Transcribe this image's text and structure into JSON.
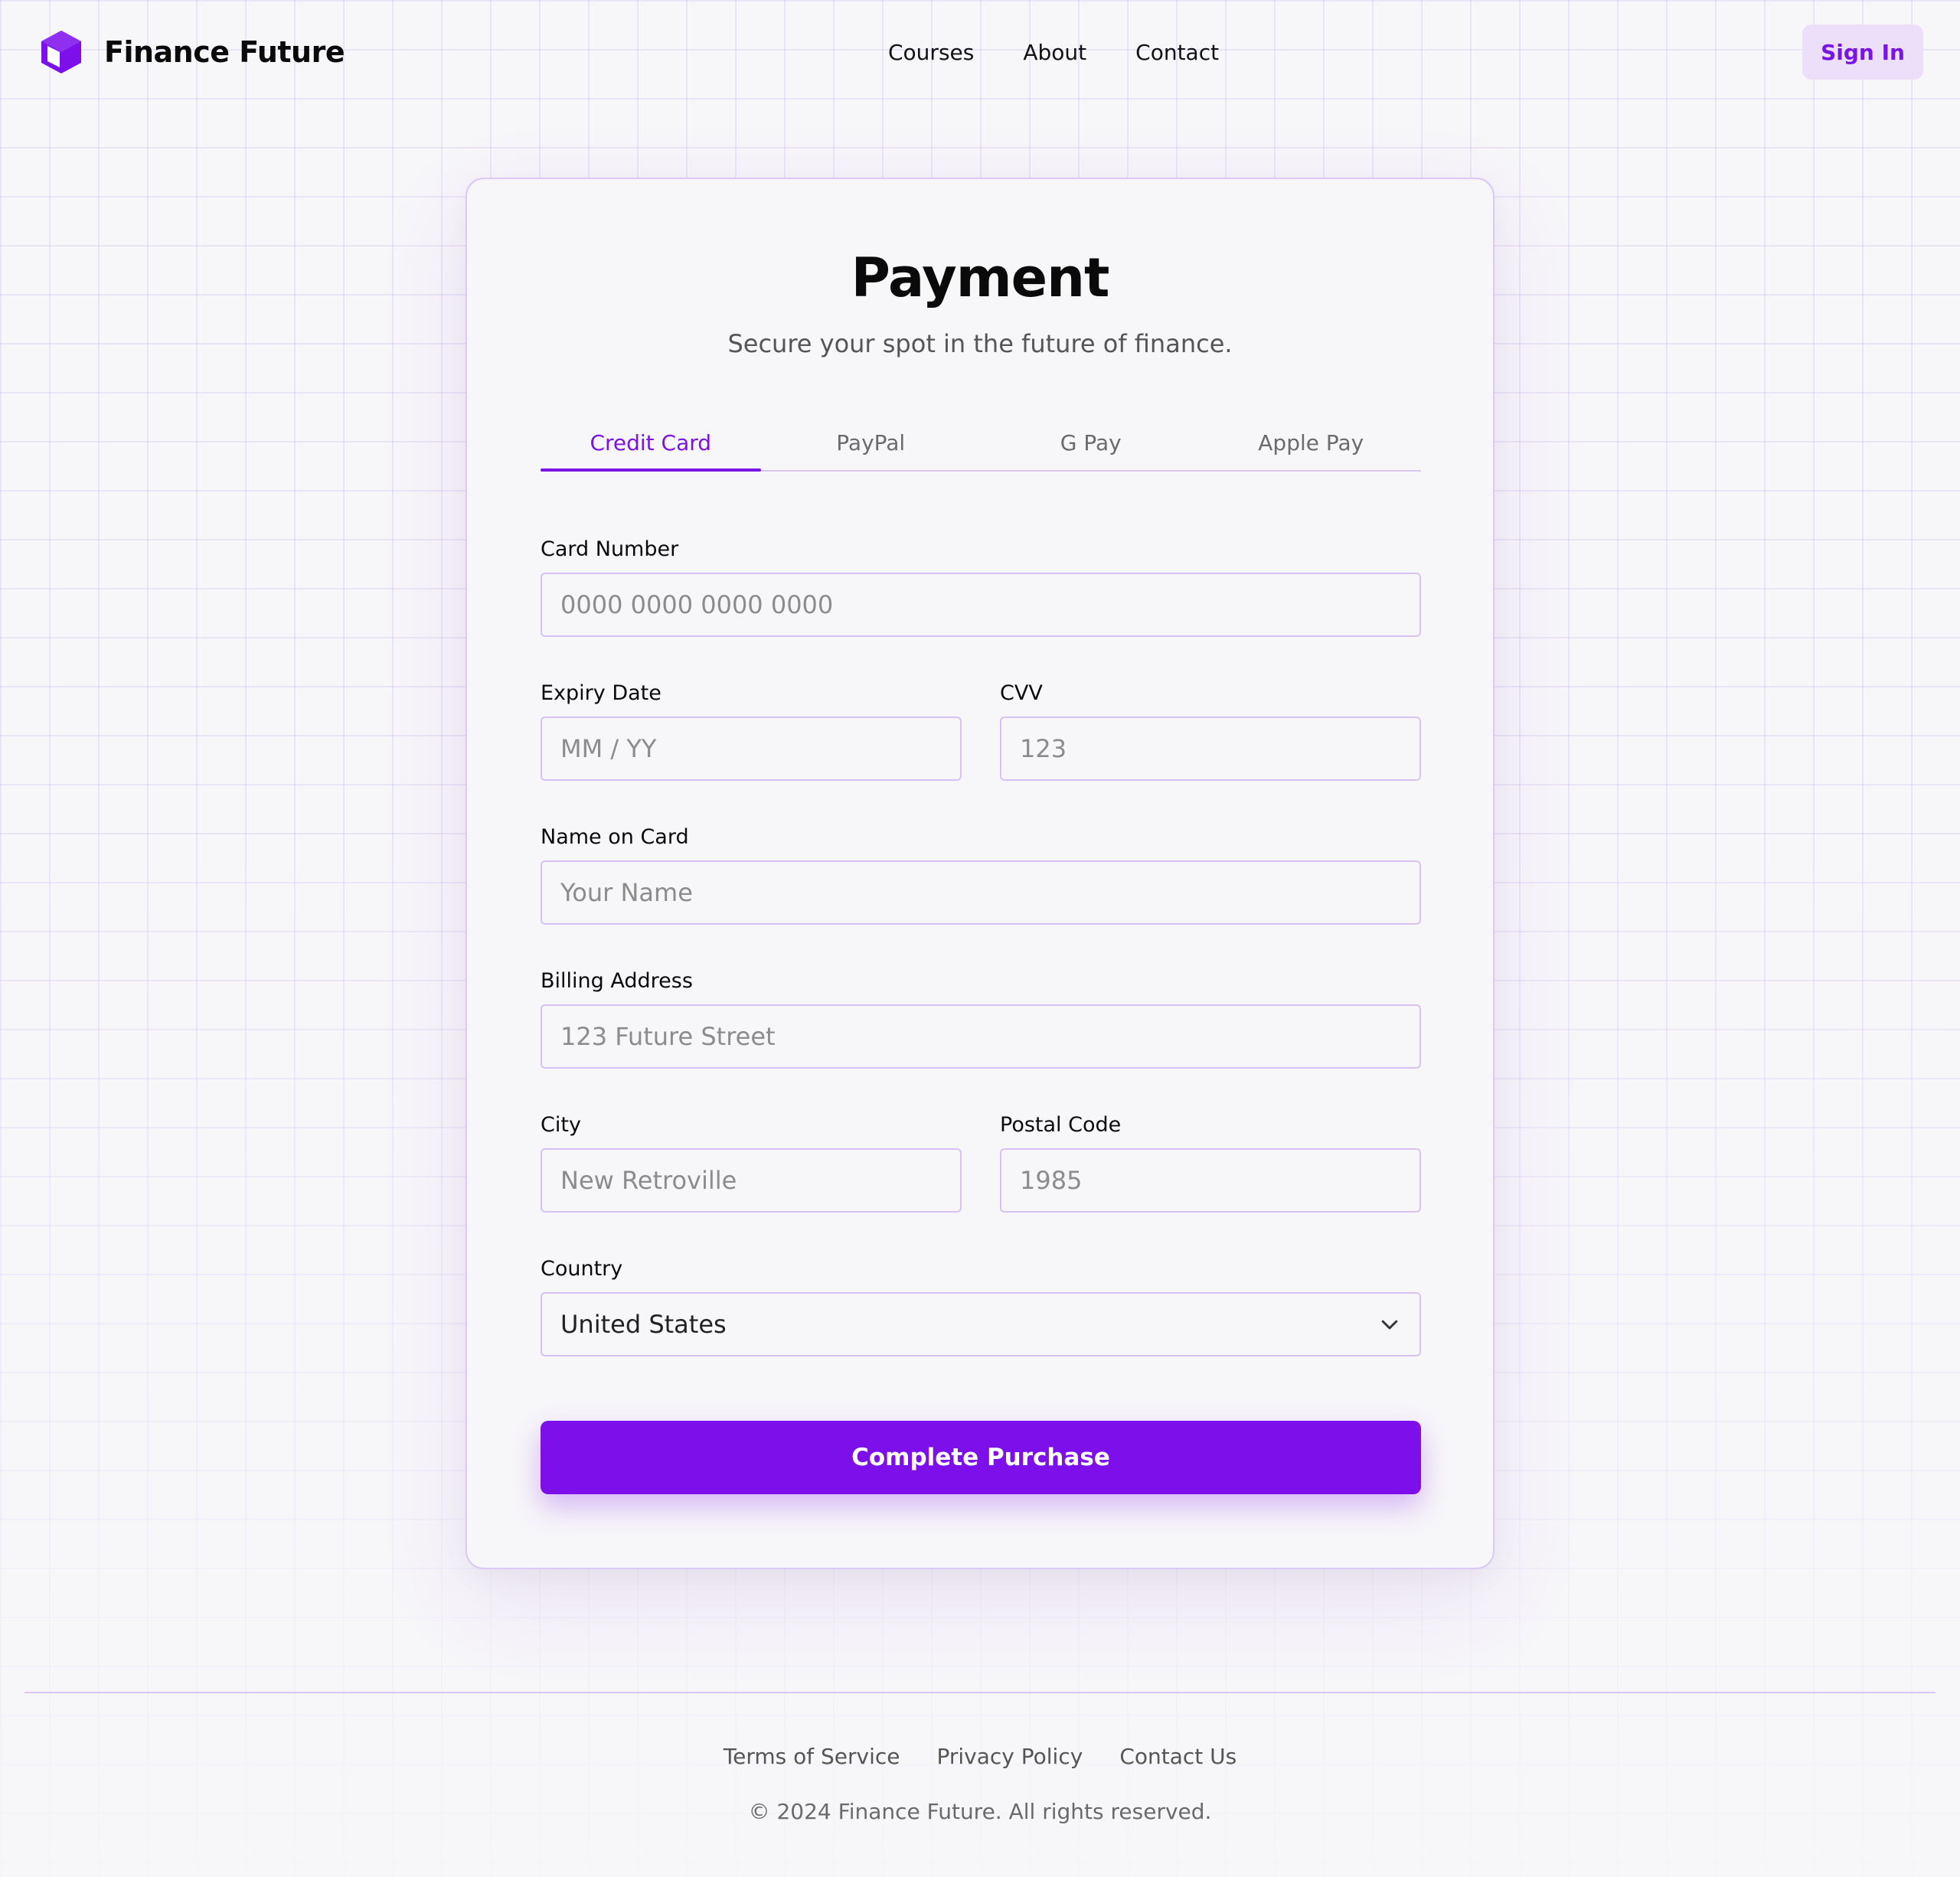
{
  "header": {
    "brand_name": "Finance Future",
    "nav": [
      "Courses",
      "About",
      "Contact"
    ],
    "signin_label": "Sign In"
  },
  "payment": {
    "title": "Payment",
    "subtitle": "Secure your spot in the future of finance.",
    "tabs": [
      "Credit Card",
      "PayPal",
      "G Pay",
      "Apple Pay"
    ],
    "active_tab": "Credit Card",
    "fields": {
      "card_number": {
        "label": "Card Number",
        "placeholder": "0000 0000 0000 0000"
      },
      "expiry": {
        "label": "Expiry Date",
        "placeholder": "MM / YY"
      },
      "cvv": {
        "label": "CVV",
        "placeholder": "123"
      },
      "name": {
        "label": "Name on Card",
        "placeholder": "Your Name"
      },
      "address": {
        "label": "Billing Address",
        "placeholder": "123 Future Street"
      },
      "city": {
        "label": "City",
        "placeholder": "New Retroville"
      },
      "postal": {
        "label": "Postal Code",
        "placeholder": "1985"
      },
      "country": {
        "label": "Country",
        "value": "United States"
      }
    },
    "submit_label": "Complete Purchase"
  },
  "footer": {
    "links": [
      "Terms of Service",
      "Privacy Policy",
      "Contact Us"
    ],
    "copyright": "© 2024 Finance Future. All rights reserved."
  },
  "colors": {
    "accent": "#7d10ea",
    "accent_light": "#ebdff9",
    "border": "#d8c2f2",
    "background": "#f7f6f9"
  },
  "icons": [
    "cube-logo-icon",
    "chevron-down-icon"
  ]
}
